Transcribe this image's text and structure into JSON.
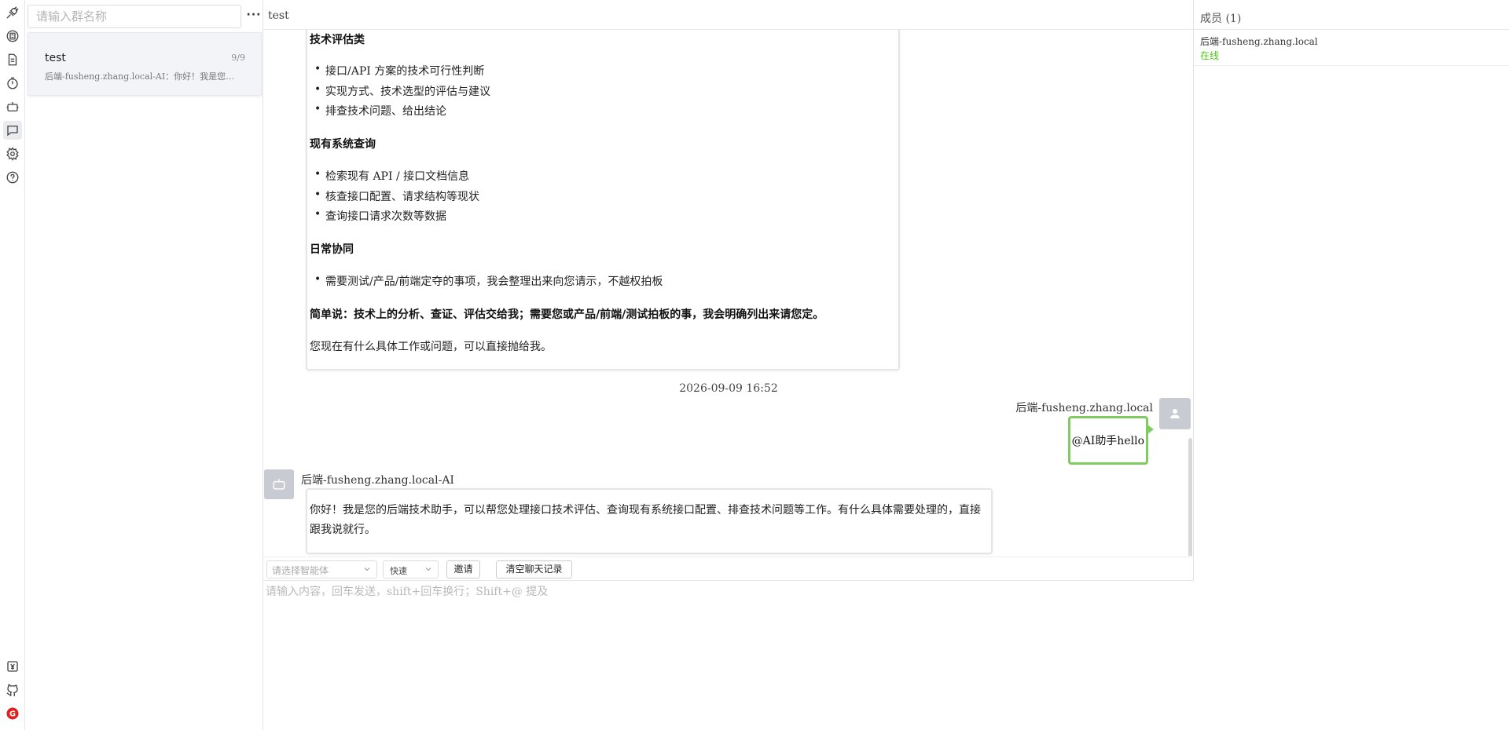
{
  "rail": {
    "items": [
      "plug-icon",
      "chip-icon",
      "document-icon",
      "timer-icon",
      "robot-icon",
      "chat-icon",
      "gear-icon",
      "help-icon",
      "yen-icon",
      "github-icon",
      "brand-logo-icon"
    ],
    "active": "chat-icon",
    "brand_logo_letter": "G"
  },
  "groups": {
    "search_placeholder": "请输入群名称",
    "more_label": "···",
    "items": [
      {
        "name": "test",
        "count": "9/9",
        "preview": "后端-fusheng.zhang.local-AI：你好！我是您…"
      }
    ]
  },
  "chat": {
    "title": "test",
    "history": {
      "section1_title": "技术评估类",
      "section1_items": [
        "接口/API 方案的技术可行性判断",
        "实现方式、技术选型的评估与建议",
        "排查技术问题、给出结论"
      ],
      "section2_title": "现有系统查询",
      "section2_items": [
        "检索现有 API / 接口文档信息",
        "核查接口配置、请求结构等现状",
        "查询接口请求次数等数据"
      ],
      "section3_title": "日常协同",
      "section3_items": [
        "需要测试/产品/前端定夺的事项，我会整理出来向您请示，不越权拍板"
      ],
      "summary": "简单说：技术上的分析、查证、评估交给我；需要您或产品/前端/测试拍板的事，我会明确列出来请您定。",
      "closing": "您现在有什么具体工作或问题，可以直接抛给我。"
    },
    "timestamp": "2026-09-09 16:52",
    "user_message": {
      "sender": "后端-fusheng.zhang.local",
      "text": "@AI助手hello"
    },
    "ai_message": {
      "sender": "后端-fusheng.zhang.local-AI",
      "text": "你好！我是您的后端技术助手，可以帮您处理接口技术评估、查询现有系统接口配置、排查技术问题等工作。有什么具体需要处理的，直接跟我说就行。"
    },
    "toolbar": {
      "agent_placeholder": "请选择智能体",
      "speed_value": "快速",
      "invite_label": "邀请",
      "clear_label": "清空聊天记录"
    },
    "composer_placeholder": "请输入内容，回车发送，shift+回车换行；Shift+@ 提及"
  },
  "members": {
    "title": "成员 (1)",
    "items": [
      {
        "name": "后端-fusheng.zhang.local",
        "status": "在线"
      }
    ]
  },
  "colors": {
    "online": "#52c41a",
    "user_bubble_border": "#7fcc60",
    "brand_red": "#e02020"
  }
}
